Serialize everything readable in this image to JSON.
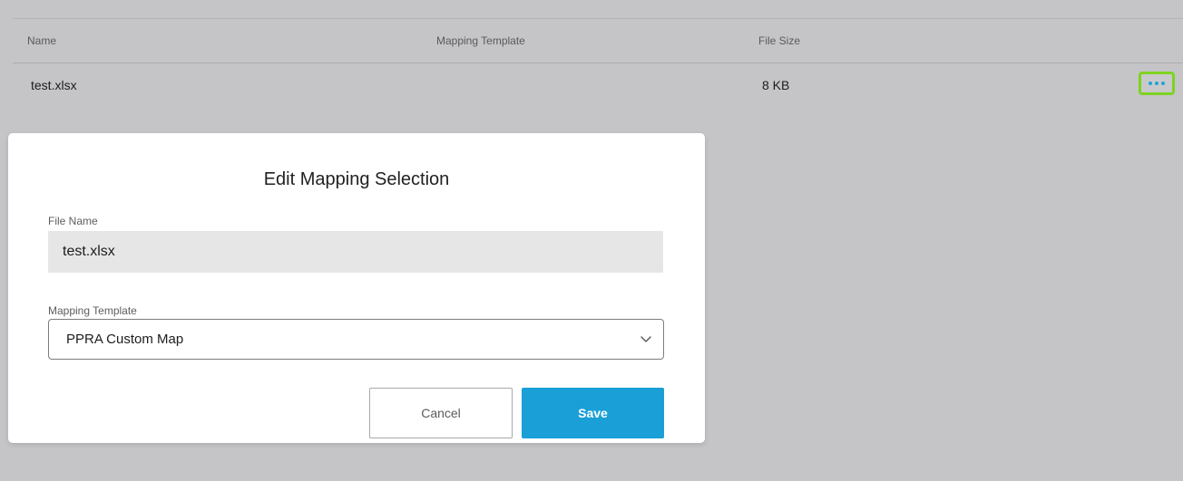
{
  "table": {
    "columns": {
      "name": "Name",
      "mapping_template": "Mapping Template",
      "file_size": "File Size"
    },
    "rows": [
      {
        "name": "test.xlsx",
        "mapping_template": "",
        "file_size": "8 KB"
      }
    ],
    "row_actions_icon": "more-horizontal-icon"
  },
  "modal": {
    "title": "Edit Mapping Selection",
    "file_name_label": "File Name",
    "file_name_value": "test.xlsx",
    "template_label": "Mapping Template",
    "template_value": "PPRA Custom Map",
    "template_icon": "chevron-down-icon",
    "cancel_label": "Cancel",
    "save_label": "Save"
  },
  "colors": {
    "overlay_background": "#c5c5c7",
    "accent": "#1a9fd6",
    "highlight": "#7ed321",
    "modal_background": "#ffffff"
  }
}
